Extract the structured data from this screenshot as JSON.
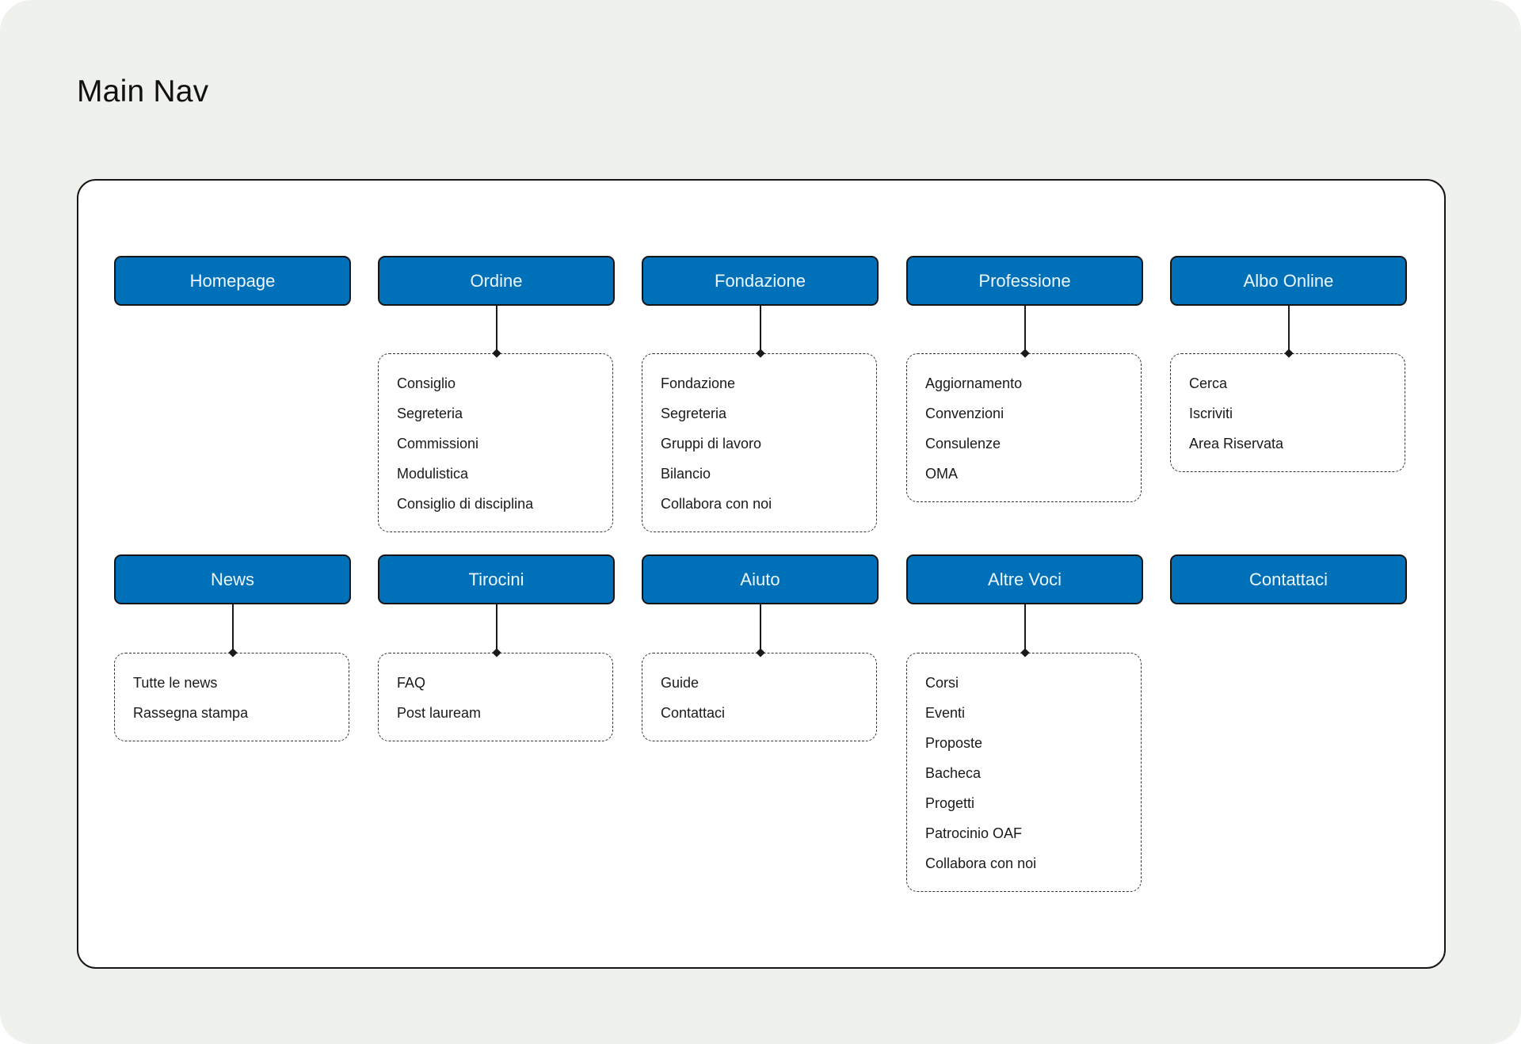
{
  "title": "Main Nav",
  "colors": {
    "background": "#eff1ec",
    "node_fill": "#0071b9",
    "node_text": "#eef7ff",
    "border": "#151515"
  },
  "nav": [
    {
      "label": "Homepage",
      "items": []
    },
    {
      "label": "Ordine",
      "items": [
        "Consiglio",
        "Segreteria",
        "Commissioni",
        "Modulistica",
        "Consiglio di disciplina"
      ]
    },
    {
      "label": "Fondazione",
      "items": [
        "Fondazione",
        "Segreteria",
        "Gruppi di lavoro",
        "Bilancio",
        "Collabora con noi"
      ]
    },
    {
      "label": "Professione",
      "items": [
        "Aggiornamento",
        "Convenzioni",
        "Consulenze",
        "OMA"
      ]
    },
    {
      "label": "Albo Online",
      "items": [
        "Cerca",
        "Iscriviti",
        "Area Riservata"
      ]
    },
    {
      "label": "News",
      "items": [
        "Tutte le news",
        "Rassegna stampa"
      ]
    },
    {
      "label": "Tirocini",
      "items": [
        "FAQ",
        "Post lauream"
      ]
    },
    {
      "label": "Aiuto",
      "items": [
        "Guide",
        "Contattaci"
      ]
    },
    {
      "label": "Altre Voci",
      "items": [
        "Corsi",
        "Eventi",
        "Proposte",
        "Bacheca",
        "Progetti",
        "Patrocinio OAF",
        "Collabora con noi"
      ]
    },
    {
      "label": "Contattaci",
      "items": []
    }
  ]
}
